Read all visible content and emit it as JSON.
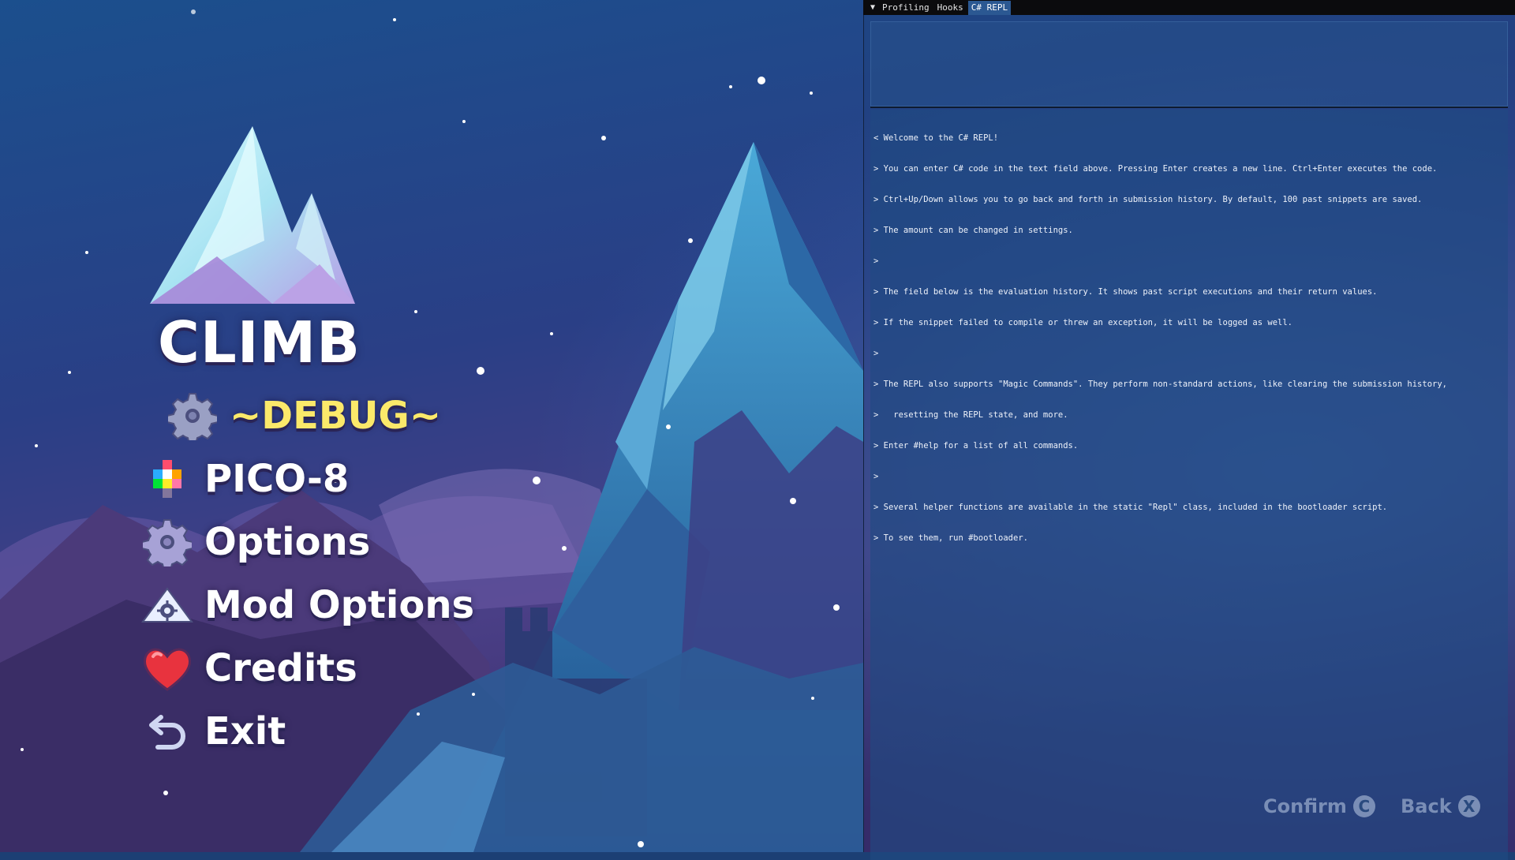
{
  "game": {
    "title": "CLIMB"
  },
  "menu": {
    "items": [
      {
        "label": "~DEBUG~",
        "icon": "gear-icon",
        "selected": true
      },
      {
        "label": "PICO-8",
        "icon": "pico8-icon",
        "selected": false
      },
      {
        "label": "Options",
        "icon": "gear-icon",
        "selected": false
      },
      {
        "label": "Mod Options",
        "icon": "mountain-gear-icon",
        "selected": false
      },
      {
        "label": "Credits",
        "icon": "heart-icon",
        "selected": false
      },
      {
        "label": "Exit",
        "icon": "back-arrow-icon",
        "selected": false
      }
    ]
  },
  "debug": {
    "tabs": [
      {
        "label": "Profiling",
        "active": false
      },
      {
        "label": "Hooks",
        "active": false
      },
      {
        "label": "C# REPL",
        "active": true
      }
    ],
    "history_lines": [
      "< Welcome to the C# REPL!",
      "> You can enter C# code in the text field above. Pressing Enter creates a new line. Ctrl+Enter executes the code.",
      "> Ctrl+Up/Down allows you to go back and forth in submission history. By default, 100 past snippets are saved.",
      "> The amount can be changed in settings.",
      ">",
      "> The field below is the evaluation history. It shows past script executions and their return values.",
      "> If the snippet failed to compile or threw an exception, it will be logged as well.",
      ">",
      "> The REPL also supports \"Magic Commands\". They perform non-standard actions, like clearing the submission history,",
      ">   resetting the REPL state, and more.",
      "> Enter #help for a list of all commands.",
      ">",
      "> Several helper functions are available in the static \"Repl\" class, included in the bootloader script.",
      "> To see them, run #bootloader."
    ]
  },
  "prompts": {
    "confirm_label": "Confirm",
    "confirm_key": "C",
    "back_label": "Back",
    "back_key": "X"
  },
  "colors": {
    "selected_menu": "#fbe96a",
    "active_tab": "#2b5892",
    "tab_bar": "#0b0b0d"
  }
}
